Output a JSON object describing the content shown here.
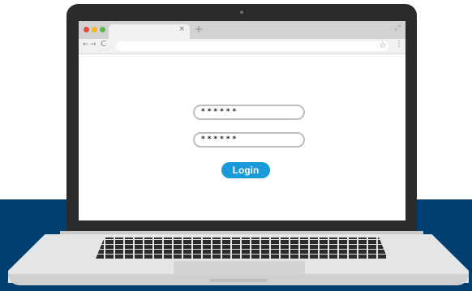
{
  "browser": {
    "tab_close": "×",
    "new_tab": "+",
    "expand": "⤢",
    "back": "←",
    "forward": "→",
    "reload": "C",
    "bookmark": "☆",
    "menu": "⋮"
  },
  "login_form": {
    "password_1": "******",
    "password_2": "******",
    "login_label": "Login"
  },
  "colors": {
    "accent": "#1a9ad9",
    "background_band": "#003f72"
  }
}
